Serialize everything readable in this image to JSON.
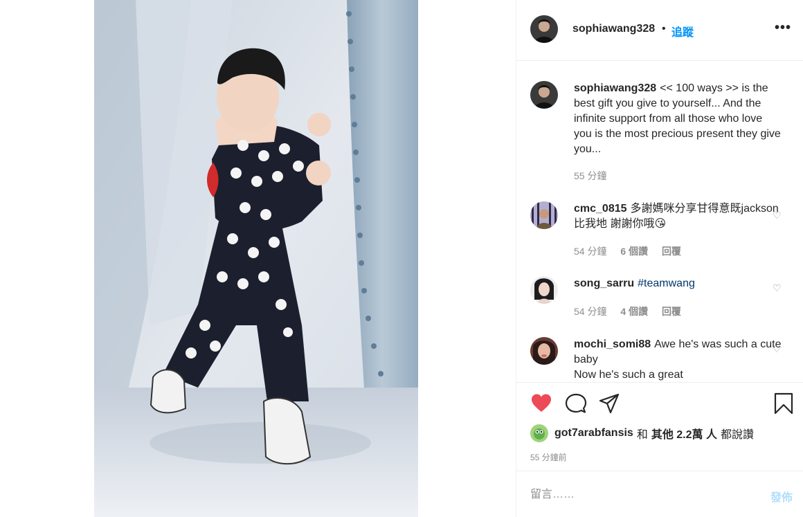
{
  "post": {
    "author": "sophiawang328",
    "dot": "•",
    "follow_label": "追蹤",
    "more_icon": "more-options-icon"
  },
  "caption": {
    "author": "sophiawang328",
    "text": "<< 100 ways >> is the best gift you give to yourself... And the infinite support from all those who love you is the most precious present they give you...",
    "time": "55 分鐘"
  },
  "comments": [
    {
      "author": "cmc_0815",
      "text": "多謝媽咪分享甘得意既jackson比我地 謝謝你哦😘",
      "time": "54 分鐘",
      "likes": "6 個讚",
      "reply": "回覆"
    },
    {
      "author": "song_sarru",
      "text": "#teamwang",
      "time": "54 分鐘",
      "likes": "4 個讚",
      "reply": "回覆"
    },
    {
      "author": "mochi_somi88",
      "text": "Awe he's was such a cute baby",
      "text2": "Now he's such a great"
    }
  ],
  "likes": {
    "user": "got7arabfansis",
    "and": "和",
    "others": "其他 2.2萬 人",
    "said": "都說讚"
  },
  "posted_ago": "55 分鐘前",
  "composer": {
    "placeholder": "留言……",
    "post_label": "發佈"
  },
  "colors": {
    "accent": "#0095f6",
    "like_red": "#ed4956",
    "post_disabled": "#b2dffc"
  }
}
